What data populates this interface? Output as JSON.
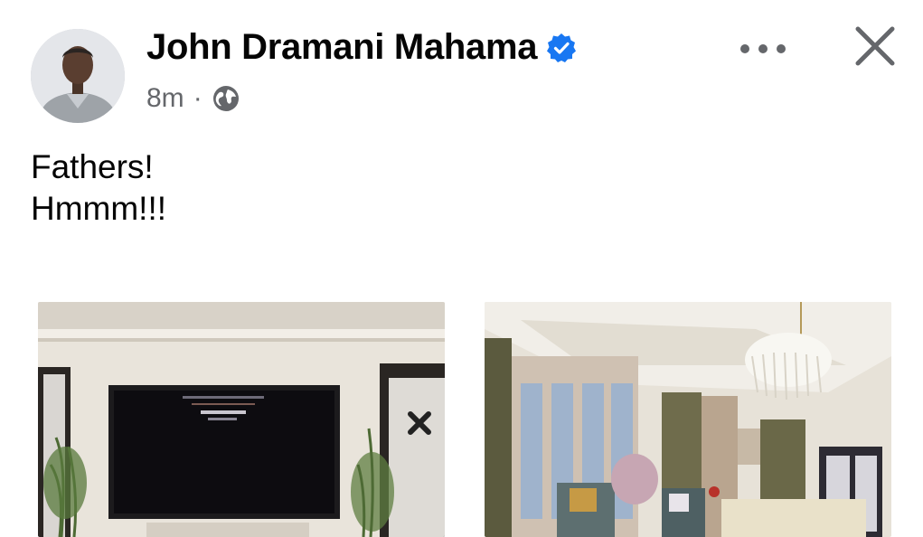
{
  "post": {
    "author": "John Dramani Mahama",
    "verified": true,
    "time": "8m",
    "separator": "·",
    "audience_icon": "globe-icon",
    "lines": [
      "Fathers!",
      "Hmmm!!!"
    ]
  },
  "header_actions": {
    "more_icon": "more-horizontal-icon",
    "close_icon": "close-icon"
  },
  "colors": {
    "verified": "#1877f2",
    "meta_text": "#65676b",
    "primary_text": "#050505"
  }
}
